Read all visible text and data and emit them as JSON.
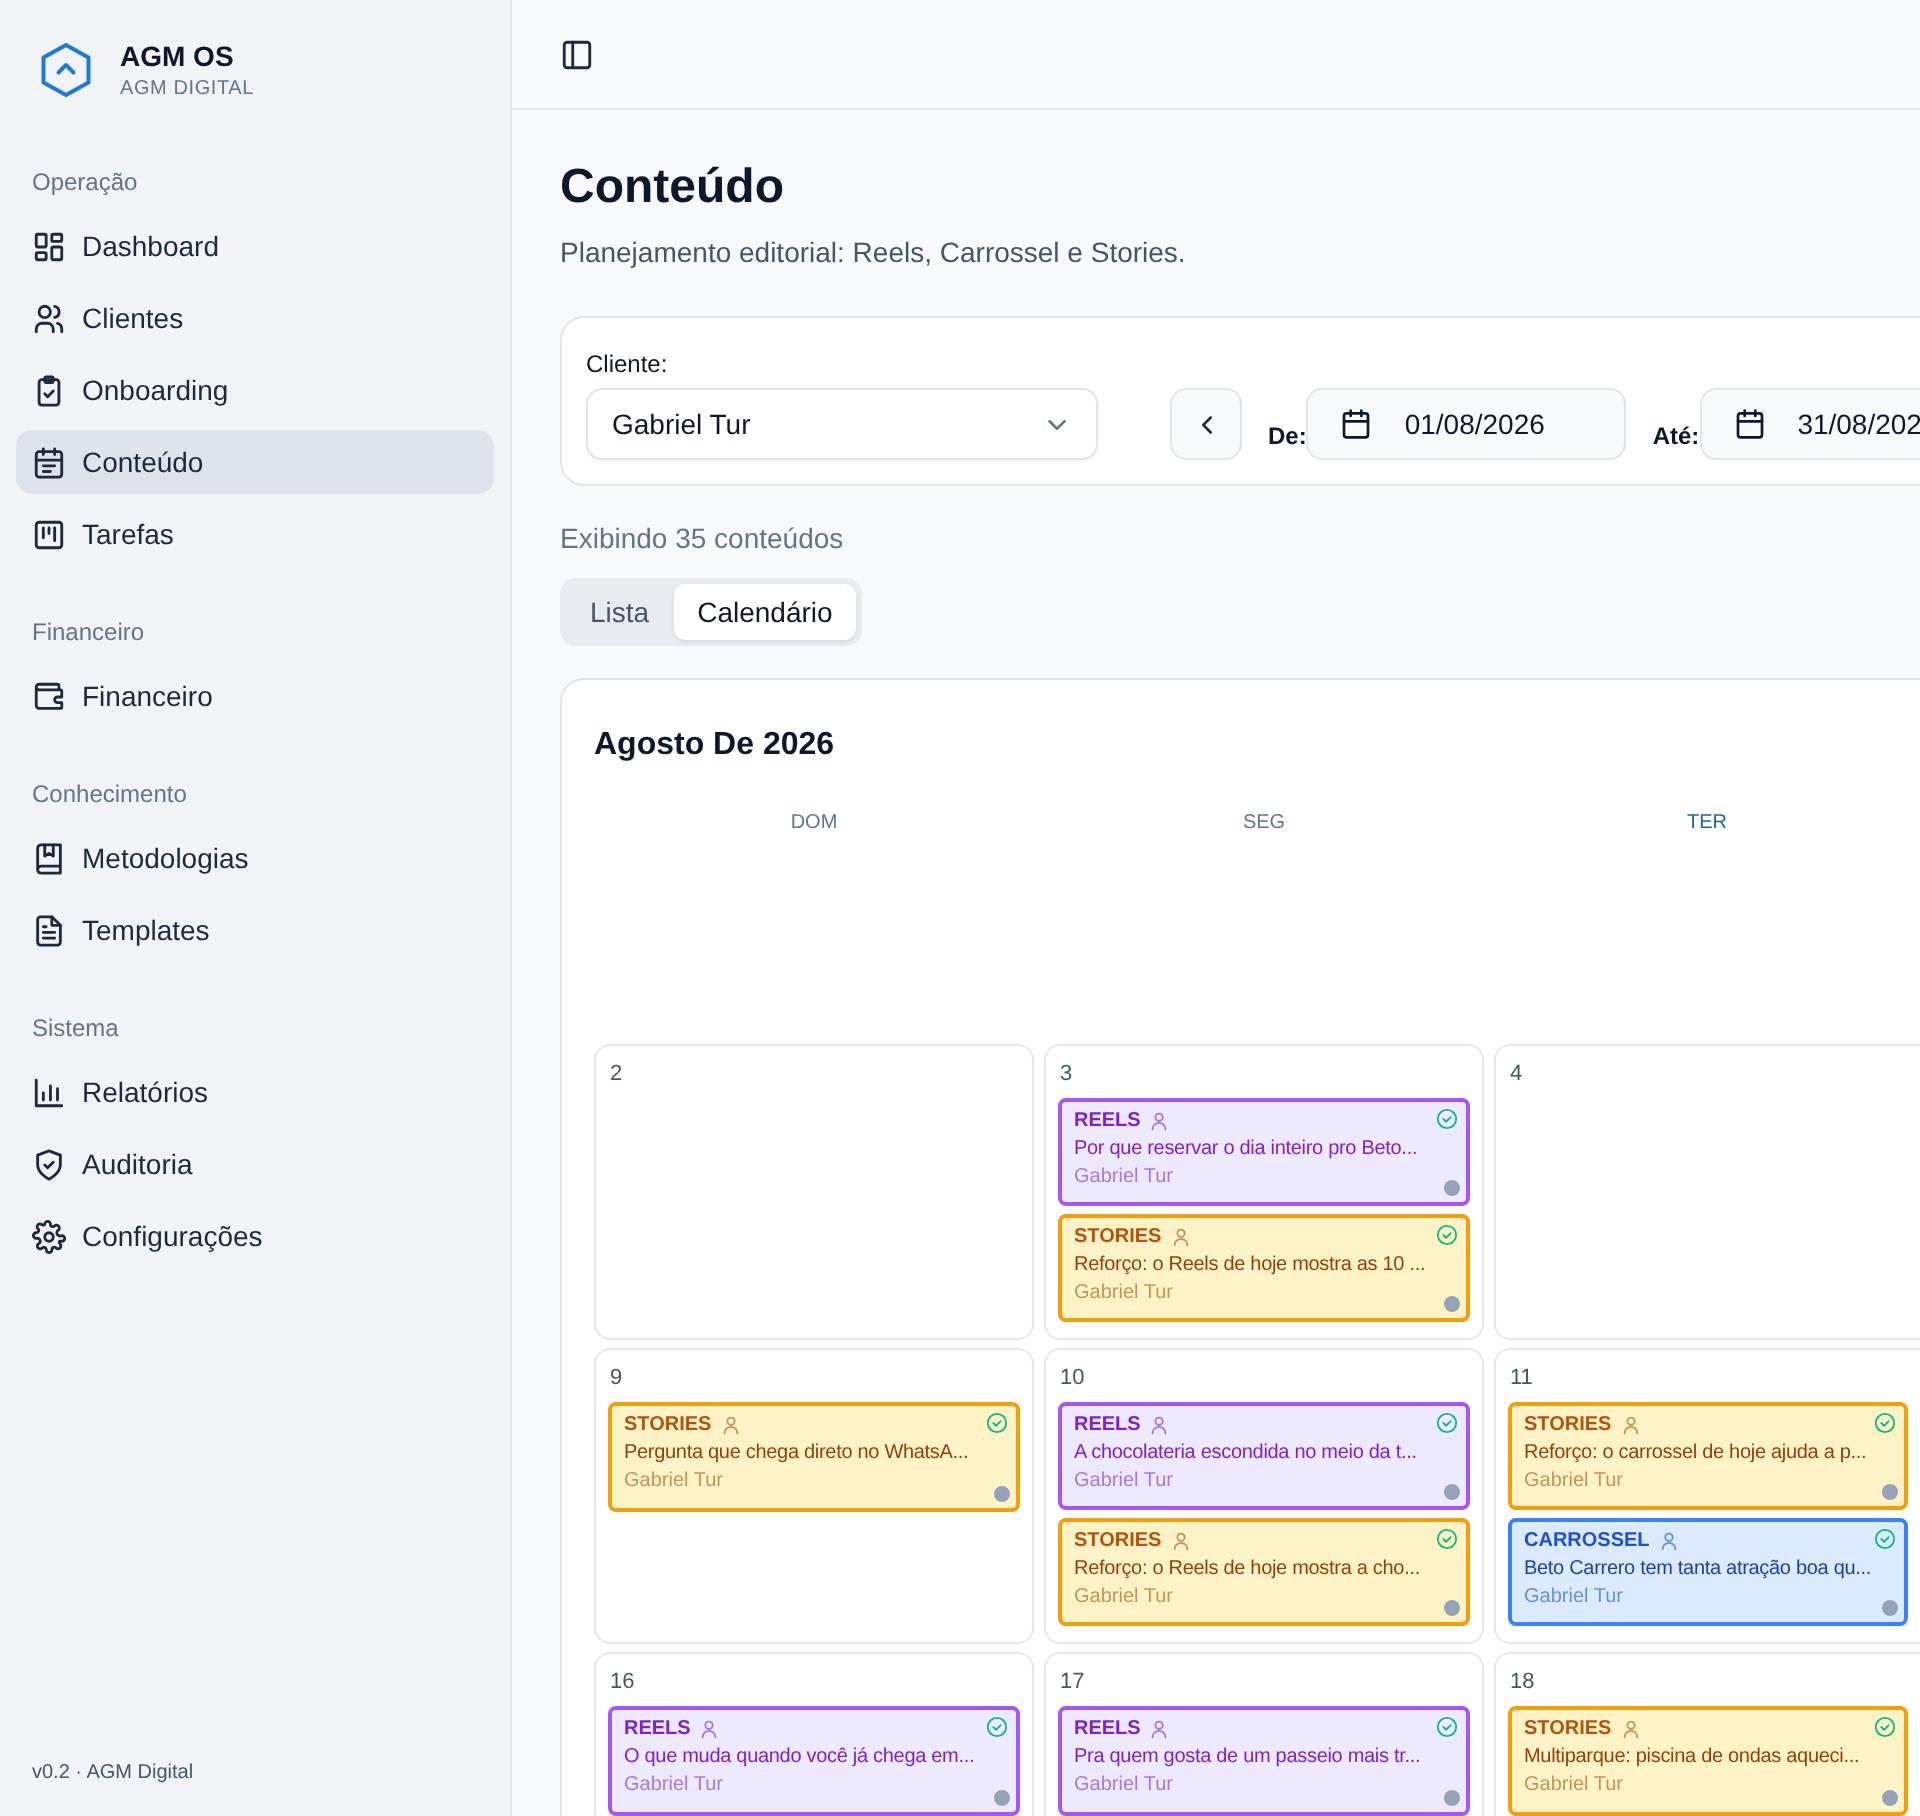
{
  "brand": {
    "name": "AGM OS",
    "subtitle": "AGM DIGITAL"
  },
  "sidebar": {
    "sections": [
      {
        "title": "Operação",
        "items": [
          {
            "label": "Dashboard",
            "selected": false
          },
          {
            "label": "Clientes",
            "selected": false
          },
          {
            "label": "Onboarding",
            "selected": false
          },
          {
            "label": "Conteúdo",
            "selected": true
          },
          {
            "label": "Tarefas",
            "selected": false
          }
        ]
      },
      {
        "title": "Financeiro",
        "items": [
          {
            "label": "Financeiro",
            "selected": false
          }
        ]
      },
      {
        "title": "Conhecimento",
        "items": [
          {
            "label": "Metodologias",
            "selected": false
          },
          {
            "label": "Templates",
            "selected": false
          }
        ]
      },
      {
        "title": "Sistema",
        "items": [
          {
            "label": "Relatórios",
            "selected": false
          },
          {
            "label": "Auditoria",
            "selected": false
          },
          {
            "label": "Configurações",
            "selected": false
          }
        ]
      }
    ],
    "footer": "v0.2 · AGM Digital"
  },
  "page": {
    "title": "Conteúdo",
    "subtitle": "Planejamento editorial: Reels, Carrossel e Stories."
  },
  "filters": {
    "client_label": "Cliente:",
    "client_value": "Gabriel Tur",
    "from_label": "De:",
    "from_value": "01/08/2026",
    "to_label": "Até:",
    "to_value": "31/08/202"
  },
  "count": "Exibindo 35 conteúdos",
  "view_tabs": [
    {
      "label": "Lista",
      "selected": false
    },
    {
      "label": "Calendário",
      "selected": true
    }
  ],
  "calendar": {
    "title": "Agosto De 2026",
    "weekdays": [
      {
        "label": "DOM",
        "highlighted": false
      },
      {
        "label": "SEG",
        "highlighted": false
      },
      {
        "label": "TER",
        "highlighted": true
      }
    ],
    "weeks": [
      [
        {
          "day": "2"
        },
        {
          "day": "3",
          "items": [
            {
              "kind": "reels",
              "type": "REELS",
              "text": "Por que reservar o dia inteiro pro Beto...",
              "client": "Gabriel Tur"
            },
            {
              "kind": "stories",
              "type": "STORIES",
              "text": "Reforço: o Reels de hoje mostra as 10 ...",
              "client": "Gabriel Tur"
            }
          ]
        },
        {
          "day": "4"
        }
      ],
      [
        {
          "day": "9",
          "items": [
            {
              "kind": "stories",
              "type": "STORIES",
              "text": "Pergunta que chega direto no WhatsA...",
              "client": "Gabriel Tur"
            }
          ]
        },
        {
          "day": "10",
          "items": [
            {
              "kind": "reels",
              "type": "REELS",
              "text": "A chocolateria escondida no meio da t...",
              "client": "Gabriel Tur"
            },
            {
              "kind": "stories",
              "type": "STORIES",
              "text": "Reforço: o Reels de hoje mostra a cho...",
              "client": "Gabriel Tur"
            }
          ]
        },
        {
          "day": "11",
          "items": [
            {
              "kind": "stories",
              "type": "STORIES",
              "text": "Reforço: o carrossel de hoje ajuda a p...",
              "client": "Gabriel Tur"
            },
            {
              "kind": "carrossel",
              "type": "CARROSSEL",
              "text": "Beto Carrero tem tanta atração boa qu...",
              "client": "Gabriel Tur"
            }
          ]
        }
      ],
      [
        {
          "day": "16",
          "items": [
            {
              "kind": "reels",
              "type": "REELS",
              "text": "O que muda quando você já chega em...",
              "client": "Gabriel Tur"
            }
          ]
        },
        {
          "day": "17",
          "items": [
            {
              "kind": "reels",
              "type": "REELS",
              "text": "Pra quem gosta de um passeio mais tr...",
              "client": "Gabriel Tur"
            }
          ]
        },
        {
          "day": "18",
          "items": [
            {
              "kind": "stories",
              "type": "STORIES",
              "text": "Multiparque: piscina de ondas aqueci...",
              "client": "Gabriel Tur"
            }
          ]
        }
      ]
    ]
  }
}
